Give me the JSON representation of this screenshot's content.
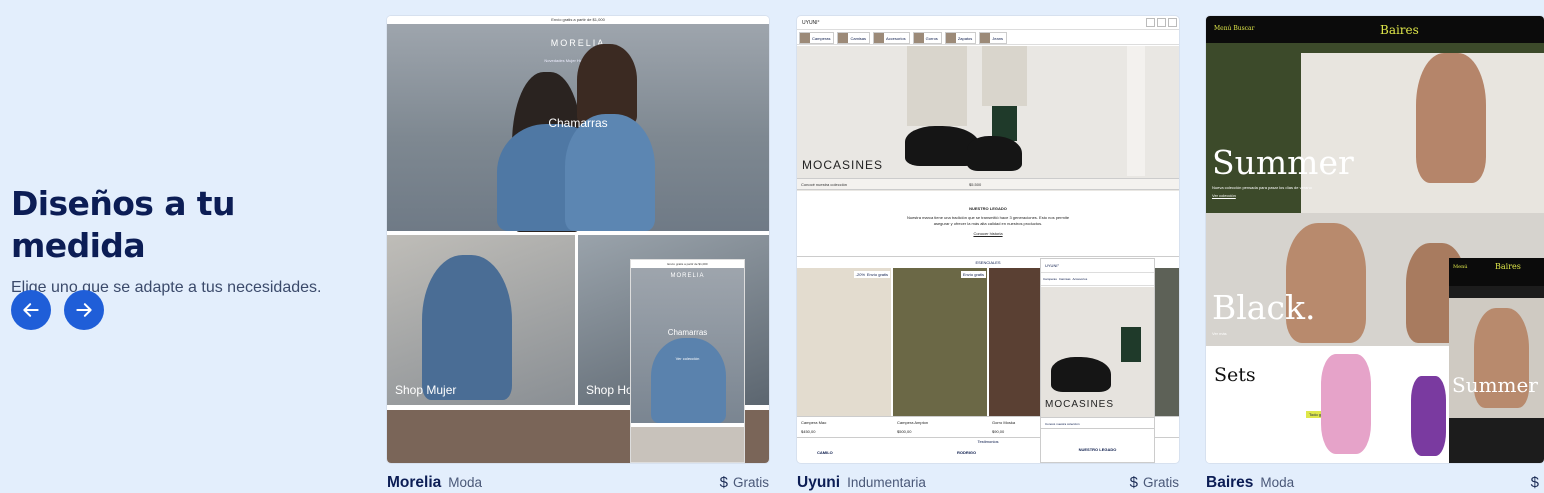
{
  "intro": {
    "title": "Diseños a tu medida",
    "subtitle": "Elige uno que se adapte a tus necesidades."
  },
  "icons": {
    "prev": "arrow-left-icon",
    "next": "arrow-right-icon",
    "price": "dollar-icon"
  },
  "colors": {
    "background": "#e3eefc",
    "accent": "#1f5ed8",
    "heading": "#0c1d55"
  },
  "themes": [
    {
      "name": "Morelia",
      "category": "Moda",
      "price_symbol": "$",
      "price": "Gratis",
      "preview": {
        "top_banner": "Envío gratis a partir de $1,000",
        "logo": "MORELIA",
        "nav": "Novedades   Mujer   Hombre   Accesorios",
        "hero_title": "Chamarras",
        "hero_text": "Descubre lo básico que estabas buscando para tu look en la ciudad",
        "hero_link": "Ver colección",
        "tile_1": "Shop Mujer",
        "tile_2": "Shop Ho",
        "mini_logo": "MORELIA",
        "mini_title": "Chamarras",
        "mini_link": "Ver colección"
      }
    },
    {
      "name": "Uyuni",
      "category": "Indumentaria",
      "price_symbol": "$",
      "price": "Gratis",
      "preview": {
        "logo": "UYUNI°",
        "categories": [
          "Camperas",
          "Camisas",
          "Accesorios",
          "Gorros",
          "Zapatos",
          "Jeans"
        ],
        "hero_title": "MOCASINES",
        "hero_bar": "Conocé nuestra colección",
        "hero_price": "$5.500",
        "legacy_title": "NUESTRO LEGADO",
        "legacy_text": "Nuestra marca tiene una tradición que se transmitió hace 3 generaciones. Esto nos permite asegurar y ofrecer la más alta calidad en nuestros productos.",
        "legacy_link": "Conocer historia",
        "essentials": "ESENCIALES",
        "badge_discount": "-20%",
        "badge_shipping": "Envío gratis",
        "products": [
          {
            "name": "Campera Mao",
            "price": "$450,00"
          },
          {
            "name": "Campera Ampton",
            "price": "$500,00"
          },
          {
            "name": "Gorro Moska",
            "price": "$90,00"
          }
        ],
        "testimonials": "Testimonios",
        "reviewers": [
          "CAMILO",
          "RODRIGO"
        ],
        "mini_logo": "UYUNI°",
        "mini_title": "MOCASINES",
        "mini_legacy": "NUESTRO LEGADO"
      }
    },
    {
      "name": "Baires",
      "category": "Moda",
      "price_symbol": "$",
      "price": "",
      "preview": {
        "menu": "Menú   Buscar",
        "logo": "Baires",
        "hero_title": "Summer",
        "hero_text": "Nueva colección pensada para pasar los días de verano",
        "hero_link": "Ver colección",
        "section_2": "Black.",
        "section_2_link": "Ver más",
        "section_3": "Sets",
        "tag": "Todo gratis",
        "mini_menu": "Menú",
        "mini_logo": "Baires",
        "mini_title": "Summer"
      }
    }
  ]
}
